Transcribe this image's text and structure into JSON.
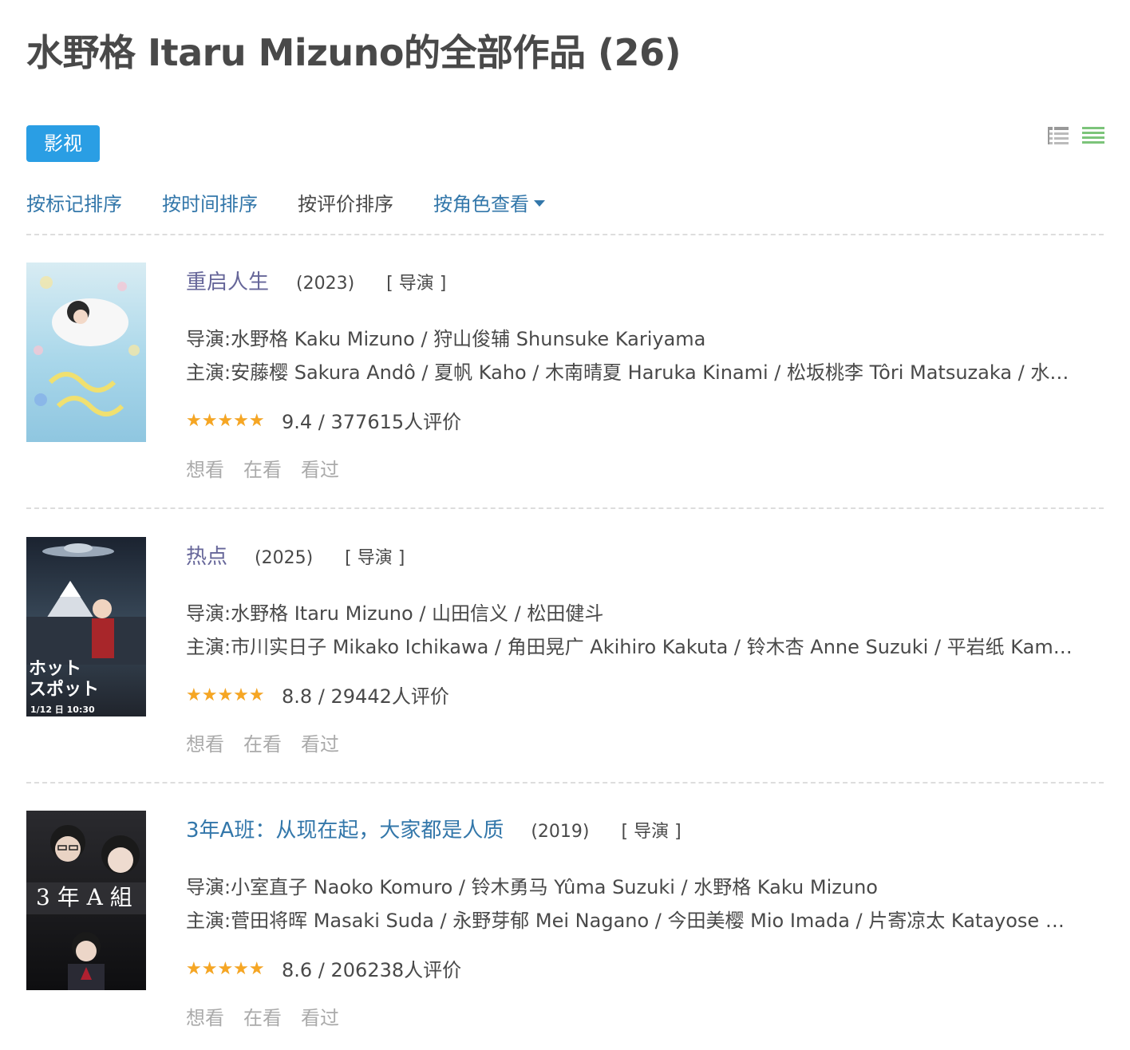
{
  "page": {
    "title": "水野格 Itaru Mizuno的全部作品 (26)",
    "category_tab": "影视",
    "view_icons": [
      "list-view-icon",
      "detail-view-icon"
    ],
    "accent_color": "#2a9ee4",
    "link_color": "#3377aa",
    "star_color": "#f6a623"
  },
  "sort": {
    "by_mark": "按标记排序",
    "by_time": "按时间排序",
    "by_rating": "按评价排序",
    "by_role": "按角色查看"
  },
  "labels": {
    "director": "导演:",
    "cast": "主演:"
  },
  "items": [
    {
      "title": "重启人生",
      "year": "(2023)",
      "role": "[ 导演 ]",
      "directors": "水野格 Kaku Mizuno / 狩山俊辅 Shunsuke Kariyama",
      "cast": "安藤樱 Sakura Andô / 夏帆 Kaho / 木南晴夏 Haruka Kinami / 松坂桃李 Tôri Matsuzaka / 水…",
      "rating_text": "9.4 / 377615人评价",
      "rating_value": 9.4,
      "actions": [
        "想看",
        "在看",
        "看过"
      ]
    },
    {
      "title": "热点",
      "year": "(2025)",
      "role": "[ 导演 ]",
      "directors": "水野格 Itaru Mizuno / 山田信义 / 松田健斗",
      "cast": "市川实日子 Mikako Ichikawa / 角田晃广 Akihiro Kakuta / 铃木杏 Anne Suzuki / 平岩纸 Kam…",
      "rating_text": "8.8 / 29442人评价",
      "rating_value": 8.8,
      "actions": [
        "想看",
        "在看",
        "看过"
      ]
    },
    {
      "title": "3年A班：从现在起，大家都是人质",
      "year": "(2019)",
      "role": "[ 导演 ]",
      "directors": "小室直子 Naoko Komuro / 铃木勇马 Yûma Suzuki / 水野格 Kaku Mizuno",
      "cast": "菅田将晖 Masaki Suda / 永野芽郁 Mei Nagano / 今田美樱 Mio Imada / 片寄凉太 Katayose …",
      "rating_text": "8.6 / 206238人评价",
      "rating_value": 8.6,
      "actions": [
        "想看",
        "在看",
        "看过"
      ]
    }
  ]
}
